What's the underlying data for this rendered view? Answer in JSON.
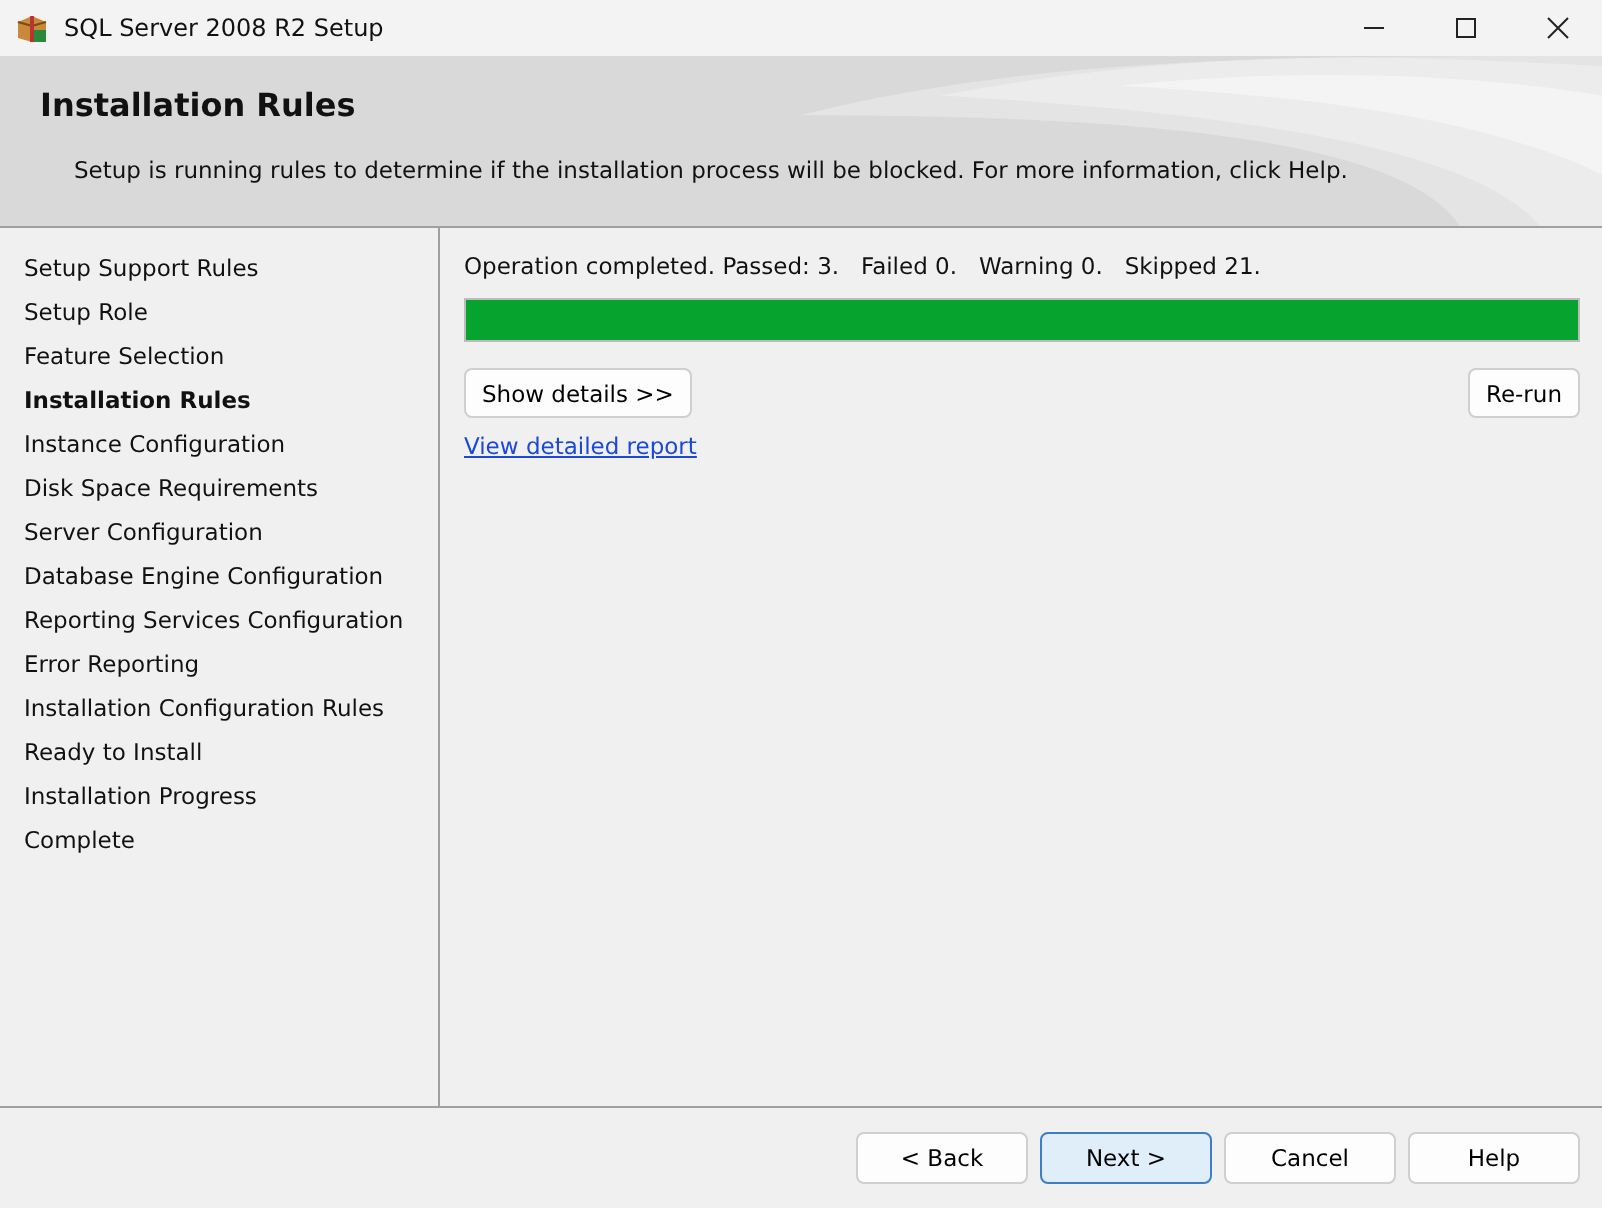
{
  "window": {
    "title": "SQL Server 2008 R2 Setup"
  },
  "header": {
    "title": "Installation Rules",
    "description": "Setup is running rules to determine if the installation process will be blocked. For more information, click Help."
  },
  "sidebar": {
    "items": [
      {
        "label": "Setup Support Rules",
        "selected": false
      },
      {
        "label": "Setup Role",
        "selected": false
      },
      {
        "label": "Feature Selection",
        "selected": false
      },
      {
        "label": "Installation Rules",
        "selected": true
      },
      {
        "label": "Instance Configuration",
        "selected": false
      },
      {
        "label": "Disk Space Requirements",
        "selected": false
      },
      {
        "label": "Server Configuration",
        "selected": false
      },
      {
        "label": "Database Engine Configuration",
        "selected": false
      },
      {
        "label": "Reporting Services Configuration",
        "selected": false
      },
      {
        "label": "Error Reporting",
        "selected": false
      },
      {
        "label": "Installation Configuration Rules",
        "selected": false
      },
      {
        "label": "Ready to Install",
        "selected": false
      },
      {
        "label": "Installation Progress",
        "selected": false
      },
      {
        "label": "Complete",
        "selected": false
      }
    ]
  },
  "content": {
    "status": "Operation completed. Passed: 3.   Failed 0.   Warning 0.   Skipped 21.",
    "progress": {
      "level": 1
    },
    "show_details": "Show details >>",
    "rerun": "Re-run",
    "report_link": "View detailed report"
  },
  "buttons": [
    {
      "label": "< Back",
      "default": false
    },
    {
      "label": "Next >",
      "default": true
    },
    {
      "label": "Cancel",
      "default": false
    },
    {
      "label": "Help",
      "default": false
    }
  ]
}
